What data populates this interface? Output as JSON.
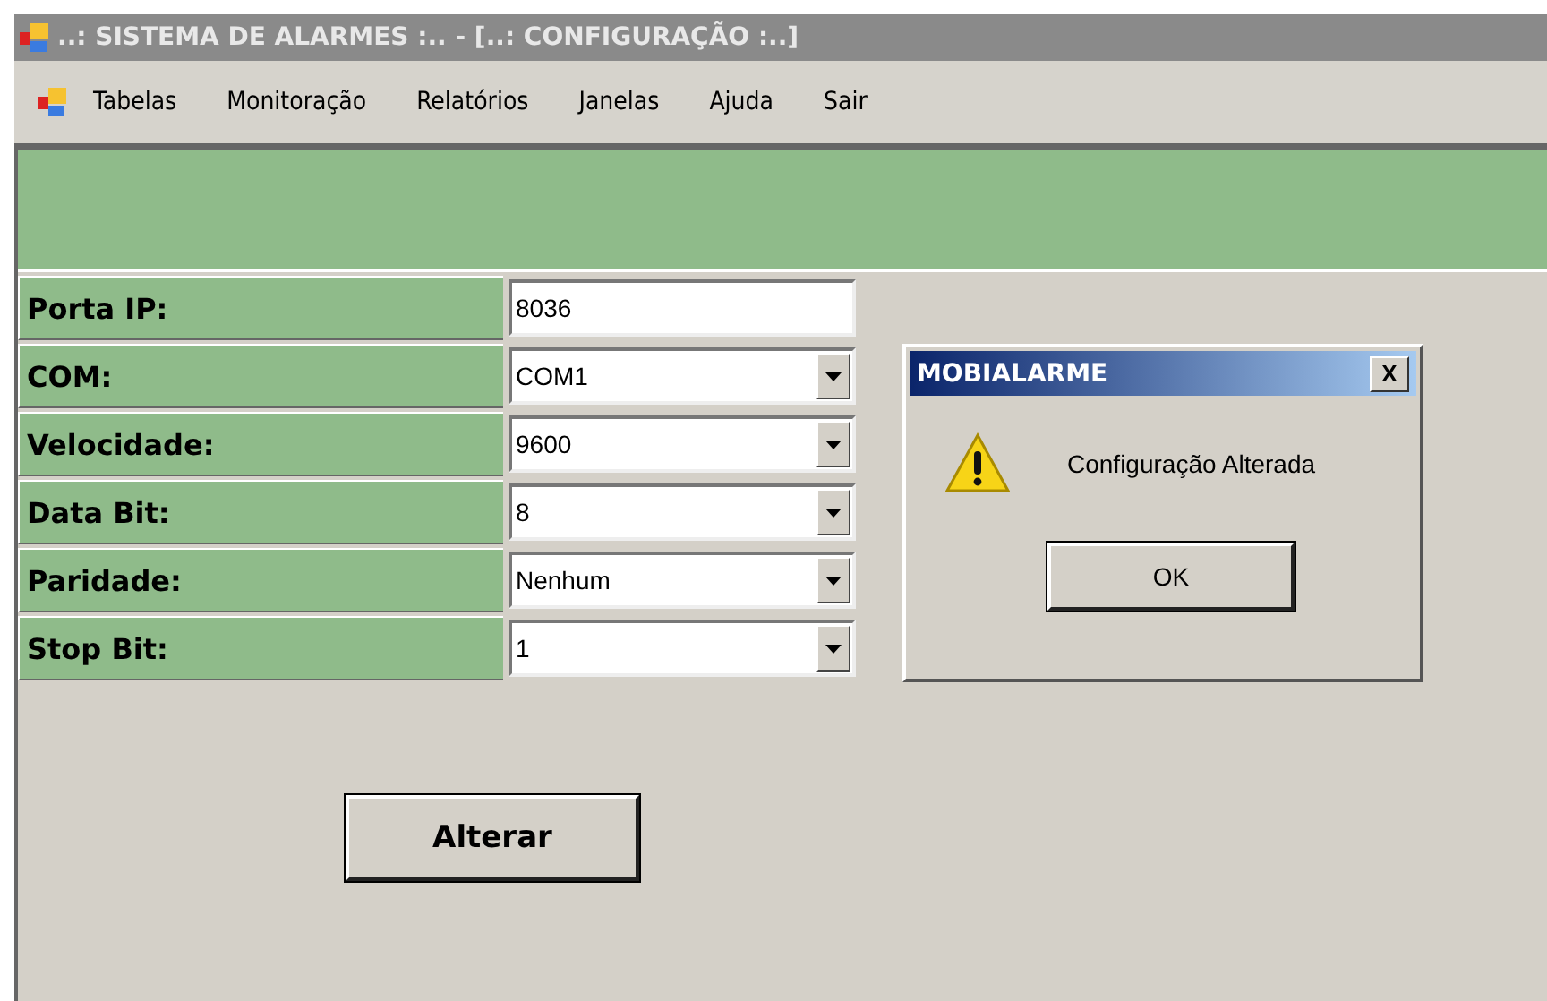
{
  "window": {
    "title": "..: SISTEMA DE ALARMES :.. - [..: CONFIGURAÇÃO :..]"
  },
  "menu": [
    "Tabelas",
    "Monitoração",
    "Relatórios",
    "Janelas",
    "Ajuda",
    "Sair"
  ],
  "fields": [
    {
      "label": "Porta IP:",
      "kind": "text",
      "value": "8036"
    },
    {
      "label": "COM:",
      "kind": "combo",
      "value": "COM1"
    },
    {
      "label": "Velocidade:",
      "kind": "combo",
      "value": "9600"
    },
    {
      "label": "Data Bit:",
      "kind": "combo",
      "value": "8"
    },
    {
      "label": "Paridade:",
      "kind": "combo",
      "value": "Nenhum"
    },
    {
      "label": "Stop Bit:",
      "kind": "combo",
      "value": "1"
    }
  ],
  "button": "Alterar",
  "dialog": {
    "title": "MOBIALARME",
    "close": "X",
    "message": "Configuração Alterada",
    "button": "OK"
  }
}
